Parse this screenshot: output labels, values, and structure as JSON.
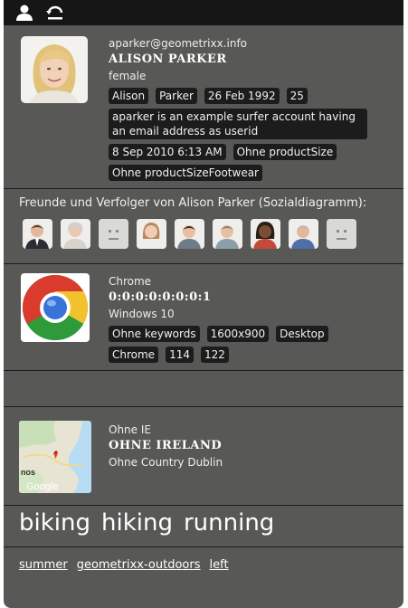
{
  "toolbar": {
    "icons": [
      "user-icon",
      "logout-icon"
    ]
  },
  "profile": {
    "email": "aparker@geometrixx.info",
    "name": "ALISON PARKER",
    "gender": "female",
    "tags": [
      "Alison",
      "Parker",
      "26 Feb 1992",
      "25"
    ],
    "description": "aparker is an example surfer account having an email address as userid",
    "tags2": [
      "8 Sep 2010 6:13 AM",
      "Ohne productSize"
    ],
    "tags3": [
      "Ohne productSizeFootwear"
    ]
  },
  "friends": {
    "title": "Freunde und Verfolger von Alison Parker (Sozialdiagramm):"
  },
  "browser": {
    "name": "Chrome",
    "ip": "0:0:0:0:0:0:0:1",
    "os": "Windows 10",
    "tags": [
      "Ohne keywords",
      "1600x900",
      "Desktop",
      "Chrome",
      "114",
      "122"
    ]
  },
  "geo": {
    "country": "Ohne IE",
    "region": "OHNE IRELAND",
    "county": "Ohne Country Dublin",
    "map_label": "Google"
  },
  "interests": [
    "biking",
    "hiking",
    "running"
  ],
  "links": [
    "summer",
    "geometrixx-outdoors",
    "left"
  ]
}
